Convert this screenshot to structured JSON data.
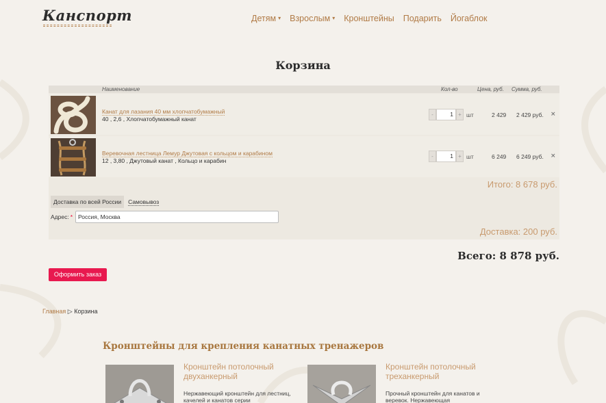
{
  "header": {
    "logo": "Канспорт",
    "nav": [
      {
        "label": "Детям",
        "caret": "▾"
      },
      {
        "label": "Взрослым",
        "caret": "▾"
      },
      {
        "label": "Кронштейны"
      },
      {
        "label": "Подарить"
      },
      {
        "label": "Йогаблок"
      }
    ]
  },
  "page_title": "Корзина",
  "cart": {
    "columns": {
      "name": "Наименование",
      "qty": "Кол-во",
      "price": "Цена, руб.",
      "sum": "Сумма, руб."
    },
    "items": [
      {
        "name": "Канат для лазания 40 мм хлопчатобумажный",
        "desc": "40 , 2,6 , Хлопчатобумажный канат",
        "qty": "1",
        "unit": "шт",
        "price": "2 429",
        "sum": "2 429 руб.",
        "minus": "-",
        "plus": "+",
        "remove": "×",
        "image_icon": "rope-coil-image"
      },
      {
        "name": "Веревочная лестница Лемур Джутовая с кольцом и карабином",
        "desc": "12 , 3,80 , Джутовый канат , Кольцо и карабин",
        "qty": "1",
        "unit": "шт",
        "price": "6 249",
        "sum": "6 249 руб.",
        "minus": "-",
        "plus": "+",
        "remove": "×",
        "image_icon": "rope-ladder-image"
      }
    ],
    "itogo": "Итого: 8 678 руб.",
    "delivery_tabs": {
      "active": "Доставка по всей России",
      "other": "Самовывоз"
    },
    "address": {
      "label": "Адрес:",
      "required": "*",
      "value": "Россия, Москва"
    },
    "delivery_cost": "Доставка: 200 руб.",
    "total": "Всего: 8 878 руб.",
    "order_button": "Оформить заказ"
  },
  "breadcrumb": {
    "home": "Главная",
    "separator": "▷",
    "current": "Корзина"
  },
  "related": {
    "title": "Кронштейны для крепления канатных тренажеров",
    "cards": [
      {
        "title": "Кронштейн потолочный двуханкерный",
        "text": "Нержавеющий кронштейн для лестниц, качелей и канатов серии"
      },
      {
        "title": "Кронштейн потолочный треханкерный",
        "text": "Прочный кронштейн для канатов и веревок. Нержавеющая"
      }
    ]
  },
  "colors": {
    "accent": "#b07a45",
    "button": "#e8194f",
    "background": "#f4f1ec"
  }
}
